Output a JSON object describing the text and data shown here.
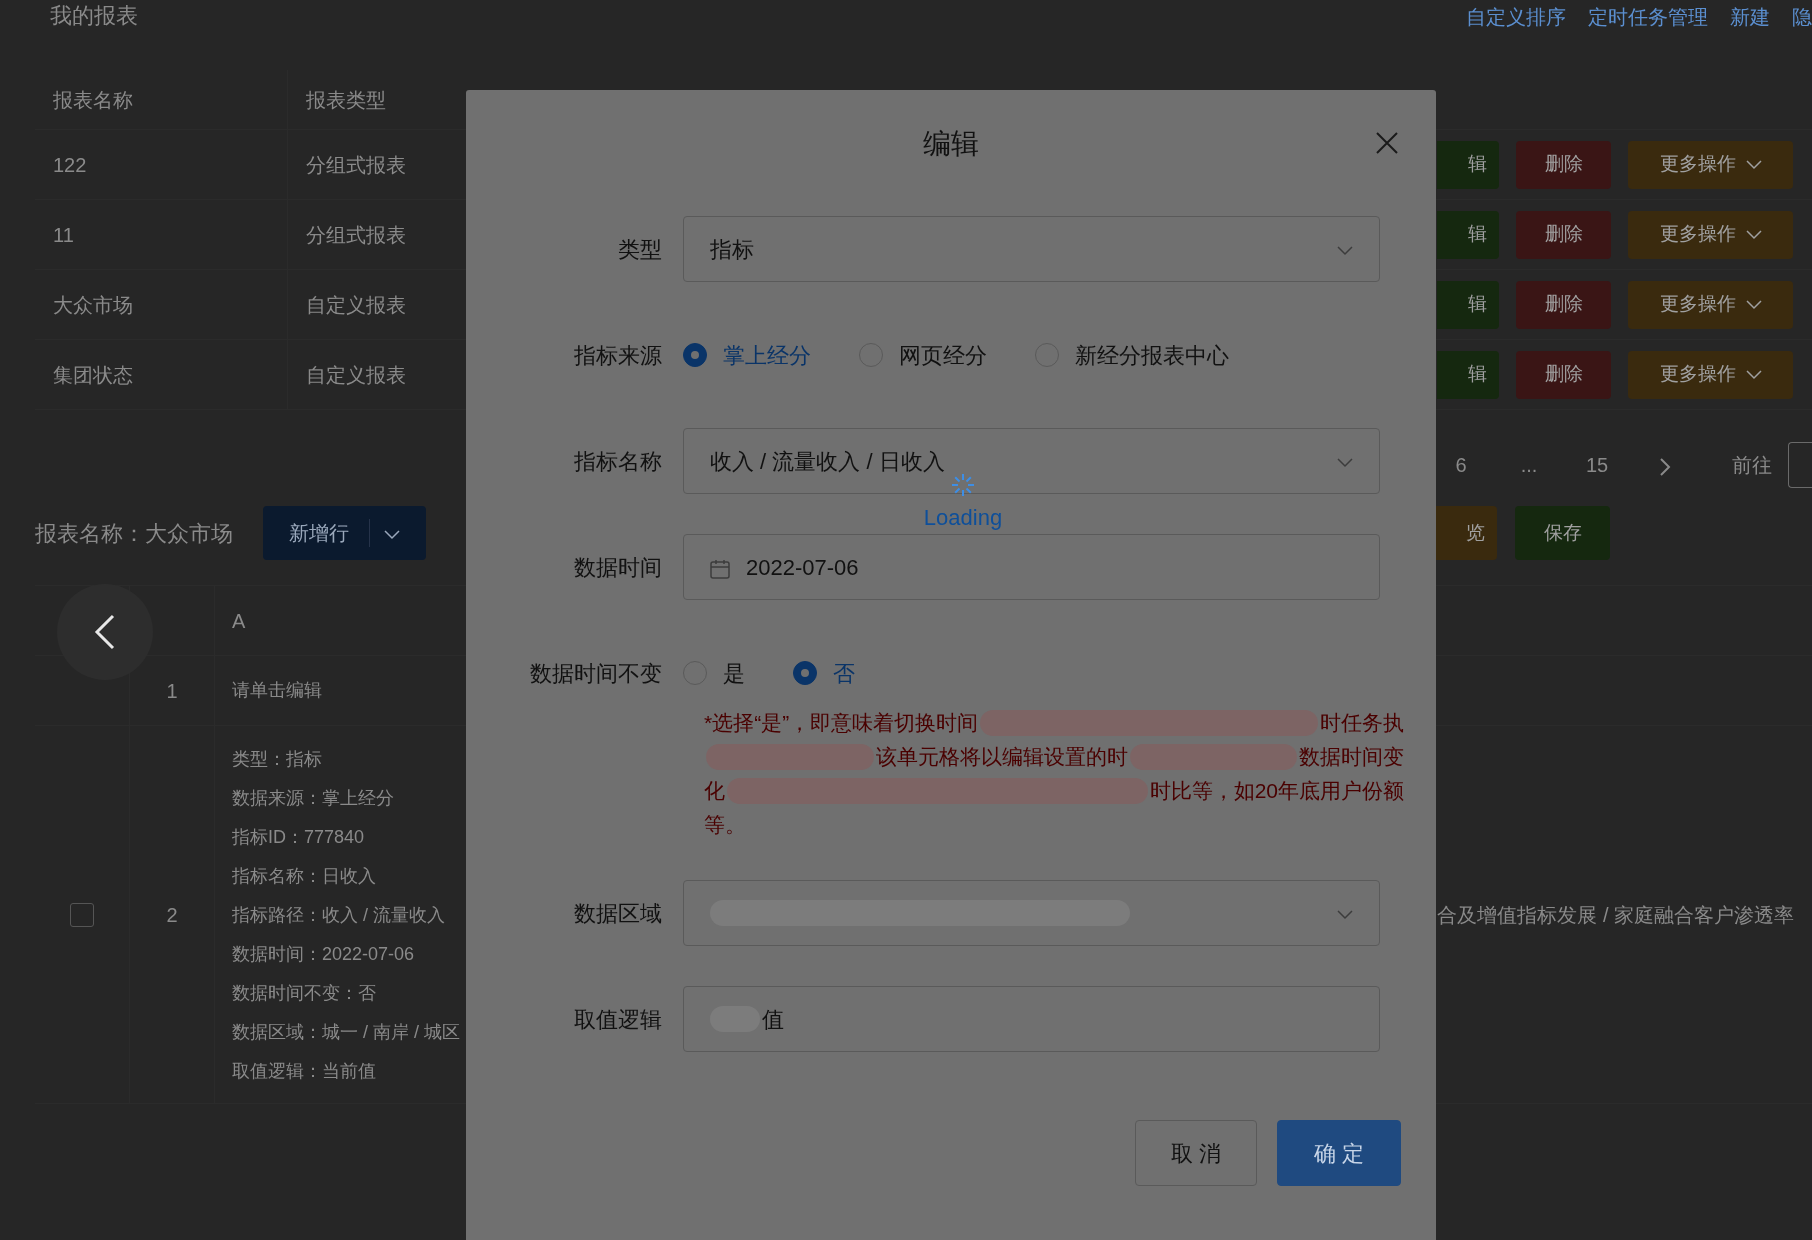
{
  "page_title": "我的报表",
  "header_links": [
    "自定义排序",
    "定时任务管理",
    "新建",
    "隐"
  ],
  "report_table": {
    "columns": [
      "报表名称",
      "报表类型"
    ],
    "rows": [
      {
        "name": "122",
        "type": "分组式报表",
        "actions": [
          {
            "kind": "edit",
            "label": "辑"
          },
          {
            "kind": "delete",
            "label": "删除"
          },
          {
            "kind": "more",
            "label": "更多操作"
          }
        ]
      },
      {
        "name": "11",
        "type": "分组式报表",
        "actions": [
          {
            "kind": "edit",
            "label": "辑"
          },
          {
            "kind": "delete",
            "label": "删除"
          },
          {
            "kind": "more",
            "label": "更多操作"
          }
        ]
      },
      {
        "name": "大众市场",
        "type": "自定义报表",
        "actions": [
          {
            "kind": "edit",
            "label": "辑"
          },
          {
            "kind": "delete",
            "label": "删除"
          },
          {
            "kind": "more",
            "label": "更多操作"
          }
        ]
      },
      {
        "name": "集团状态",
        "type": "自定义报表",
        "actions": [
          {
            "kind": "edit",
            "label": "辑"
          },
          {
            "kind": "delete",
            "label": "删除"
          },
          {
            "kind": "more",
            "label": "更多操作"
          }
        ]
      }
    ]
  },
  "pagination": {
    "pages": [
      "6",
      "...",
      "15"
    ],
    "goto_label": "前往"
  },
  "report_name_label": "报表名称：大众市场",
  "add_row_button": "新增行",
  "toolbar_buttons": [
    {
      "kind": "preview",
      "label": "览"
    },
    {
      "kind": "save",
      "label": "保存"
    }
  ],
  "sheet": {
    "column": "A",
    "rows": [
      {
        "number": "1",
        "lines": [
          "请单击编辑"
        ]
      },
      {
        "number": "2",
        "checkbox": {
          "checked": false
        },
        "lines": [
          "类型：指标",
          "数据来源：掌上经分",
          "指标ID：777840",
          "指标名称：日收入",
          "指标路径：收入 / 流量收入",
          "数据时间：2022-07-06",
          "数据时间不变：否",
          "数据区域：城一 / 南岸 / 城区",
          "取值逻辑：当前值"
        ],
        "column_2": "合及增值指标发展 / 家庭融合客户渗透率"
      }
    ]
  },
  "dialog": {
    "title": "编辑",
    "fields": [
      {
        "kind": "select",
        "label": "类型",
        "value": "指标"
      },
      {
        "kind": "radio",
        "label": "指标来源",
        "options": [
          {
            "label": "掌上经分",
            "selected": true
          },
          {
            "label": "网页经分",
            "selected": false
          },
          {
            "label": "新经分报表中心",
            "selected": false
          }
        ]
      },
      {
        "kind": "select",
        "label": "指标名称",
        "value": "收入 / 流量收入 / 日收入"
      },
      {
        "kind": "date",
        "label": "数据时间",
        "value": "2022-07-06"
      },
      {
        "kind": "radio",
        "label": "数据时间不变",
        "options": [
          {
            "label": "是",
            "selected": false
          },
          {
            "label": "否",
            "selected": true
          }
        ],
        "note_lines": [
          [
            {
              "kind": "text",
              "text": "*选择“是”，即意味着切换时间"
            },
            {
              "kind": "redacted"
            },
            {
              "kind": "text",
              "text": "时任务执"
            }
          ],
          [
            {
              "kind": "redacted"
            },
            {
              "kind": "text",
              "text": "该单元格将以编辑设置的时"
            },
            {
              "kind": "redacted"
            },
            {
              "kind": "text",
              "text": "数据时间变"
            }
          ],
          [
            {
              "kind": "text",
              "text": "化"
            },
            {
              "kind": "redacted"
            },
            {
              "kind": "text",
              "text": "时比等，如20年底用户份额"
            }
          ],
          [
            {
              "kind": "text",
              "text": "等。"
            }
          ]
        ]
      },
      {
        "kind": "select",
        "label": "数据区域",
        "redacted": true
      },
      {
        "kind": "text",
        "label": "取值逻辑",
        "redacted": true,
        "value": "值"
      }
    ],
    "loading": "Loading",
    "buttons": [
      {
        "kind": "secondary",
        "label": "取 消"
      },
      {
        "kind": "primary",
        "label": "确 定"
      }
    ]
  }
}
